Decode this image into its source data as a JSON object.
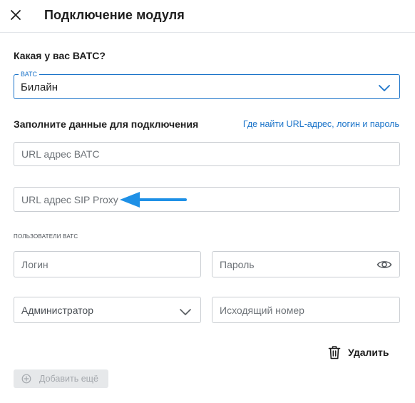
{
  "header": {
    "title": "Подключение модуля"
  },
  "vats_question": "Какая у вас ВАТС?",
  "vats_select": {
    "legend": "ВАТС",
    "value": "Билайн"
  },
  "connection": {
    "title": "Заполните данные для подключения",
    "help_link": "Где найти URL-адрес, логин и пароль",
    "url_placeholder": "URL адрес ВАТС",
    "sip_placeholder": "URL адрес SIP Proxy"
  },
  "users": {
    "label": "ПОЛЬЗОВАТЕЛИ ВАТС",
    "login_placeholder": "Логин",
    "password_placeholder": "Пароль",
    "role_value": "Администратор",
    "outgoing_placeholder": "Исходящий номер"
  },
  "actions": {
    "delete_label": "Удалить",
    "add_label": "Добавить ещё"
  },
  "colors": {
    "accent": "#1a73c9",
    "arrow": "#1e90e6"
  },
  "icons": {
    "close": "close-icon",
    "chevron": "chevron-down-icon",
    "eye": "eye-icon",
    "trash": "trash-icon",
    "plus": "plus-circle-icon"
  }
}
